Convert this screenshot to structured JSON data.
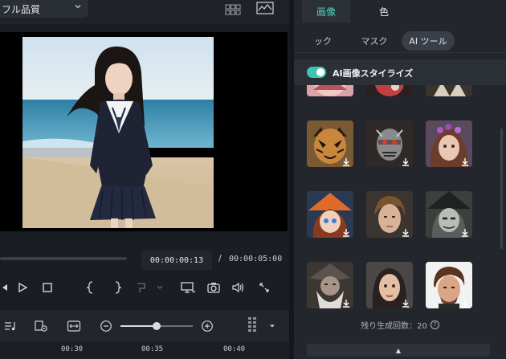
{
  "player": {
    "quality_label": "フル品質",
    "current_time": "00:00:00:13",
    "separator": "/",
    "total_time": "00:00:05:00",
    "progress": 0
  },
  "timeline": {
    "ticks": [
      "00:30",
      "00:35",
      "00:40"
    ],
    "zoom_level": 0.5
  },
  "panel": {
    "main_tabs": [
      {
        "label": "画像",
        "active": true
      },
      {
        "label": "色",
        "active": false
      }
    ],
    "sub_tabs": [
      {
        "label": "ック",
        "active": false
      },
      {
        "label": "マスク",
        "active": false
      },
      {
        "label": "AI ツール",
        "active": true
      }
    ],
    "toggle_label": "AI画像スタイライズ",
    "toggle_on": true,
    "remaining_text": "残り生成回数：20",
    "help_glyph": "?",
    "collapse_glyph": "▲"
  },
  "colors": {
    "accent": "#4fd4c0",
    "toggle": "#3fc4b0",
    "panel_bg": "#23272d",
    "app_bg": "#1a1d22"
  },
  "icons": [
    "chevron-down-icon",
    "grid-view-icon",
    "waveform-icon",
    "step-back-icon",
    "play-icon",
    "stop-icon",
    "mark-in-icon",
    "mark-out-icon",
    "insert-icon",
    "display-icon",
    "snapshot-icon",
    "volume-icon",
    "fullscreen-icon",
    "audio-track-icon",
    "clip-icon",
    "fit-icon",
    "zoom-out-icon",
    "zoom-in-icon",
    "columns-icon",
    "more-icon",
    "download-icon",
    "help-icon",
    "collapse-icon"
  ]
}
